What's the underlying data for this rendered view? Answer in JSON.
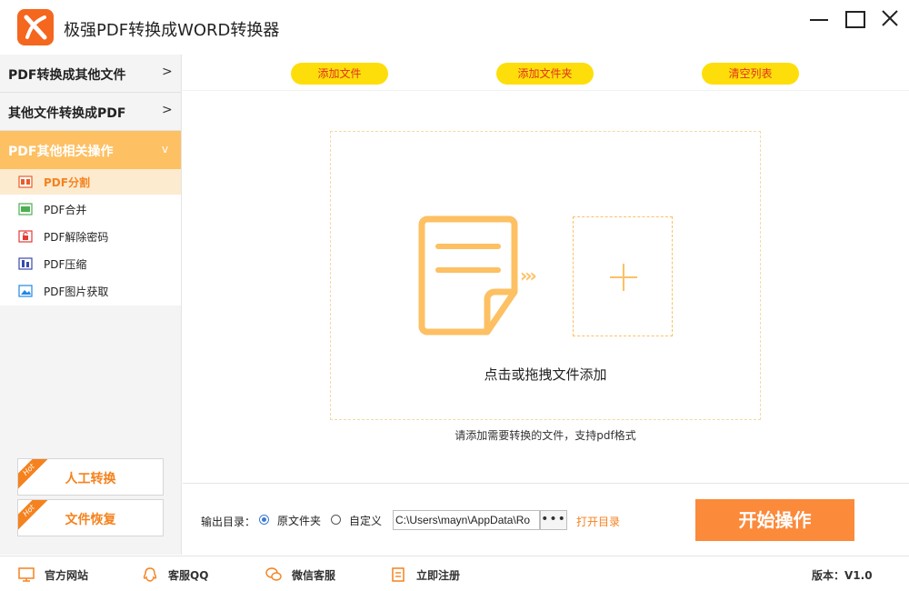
{
  "window": {
    "title": "极强PDF转换成WORD转换器",
    "logo_icon": "x-logo-icon",
    "brand_color": "#f5661e"
  },
  "sidebar": {
    "categories": [
      {
        "label": "PDF转换成其他文件",
        "arrow": ">",
        "expanded": false
      },
      {
        "label": "其他文件转换成PDF",
        "arrow": ">",
        "expanded": false
      },
      {
        "label": "PDF其他相关操作",
        "arrow": "v",
        "expanded": true
      }
    ],
    "sub_items": [
      {
        "label": "PDF分割",
        "icon": "pdf-split-icon",
        "active": true
      },
      {
        "label": "PDF合并",
        "icon": "pdf-merge-icon",
        "active": false
      },
      {
        "label": "PDF解除密码",
        "icon": "pdf-unlock-icon",
        "active": false
      },
      {
        "label": "PDF压缩",
        "icon": "pdf-compress-icon",
        "active": false
      },
      {
        "label": "PDF图片获取",
        "icon": "pdf-image-icon",
        "active": false
      }
    ],
    "bottom_buttons": [
      {
        "label": "人工转换",
        "badge": "Hot"
      },
      {
        "label": "文件恢复",
        "badge": "Hot"
      }
    ]
  },
  "toolbar": {
    "add_file": "添加文件",
    "add_folder": "添加文件夹",
    "clear_list": "清空列表"
  },
  "dropzone": {
    "prompt": "点击或拖拽文件添加",
    "chevrons": "›››",
    "hint": "请添加需要转换的文件，支持pdf格式"
  },
  "output": {
    "label": "输出目录：",
    "option_original": "原文件夹",
    "option_custom": "自定义",
    "selected": "original",
    "path_value": "C:\\Users\\mayn\\AppData\\Ro",
    "browse_label": "•••",
    "open_dir": "打开目录",
    "start_button": "开始操作"
  },
  "statusbar": {
    "items": [
      {
        "label": "官方网站",
        "icon": "monitor-icon"
      },
      {
        "label": "客服QQ",
        "icon": "qq-penguin-icon"
      },
      {
        "label": "微信客服",
        "icon": "wechat-icon"
      },
      {
        "label": "立即注册",
        "icon": "register-icon"
      }
    ],
    "version": "版本：V1.0"
  },
  "colors": {
    "accent_orange": "#f5821e",
    "sidebar_active": "#fdc063",
    "pill_yellow": "#fede0a",
    "pill_text": "#e0301e",
    "start_button": "#fb8a3b"
  }
}
